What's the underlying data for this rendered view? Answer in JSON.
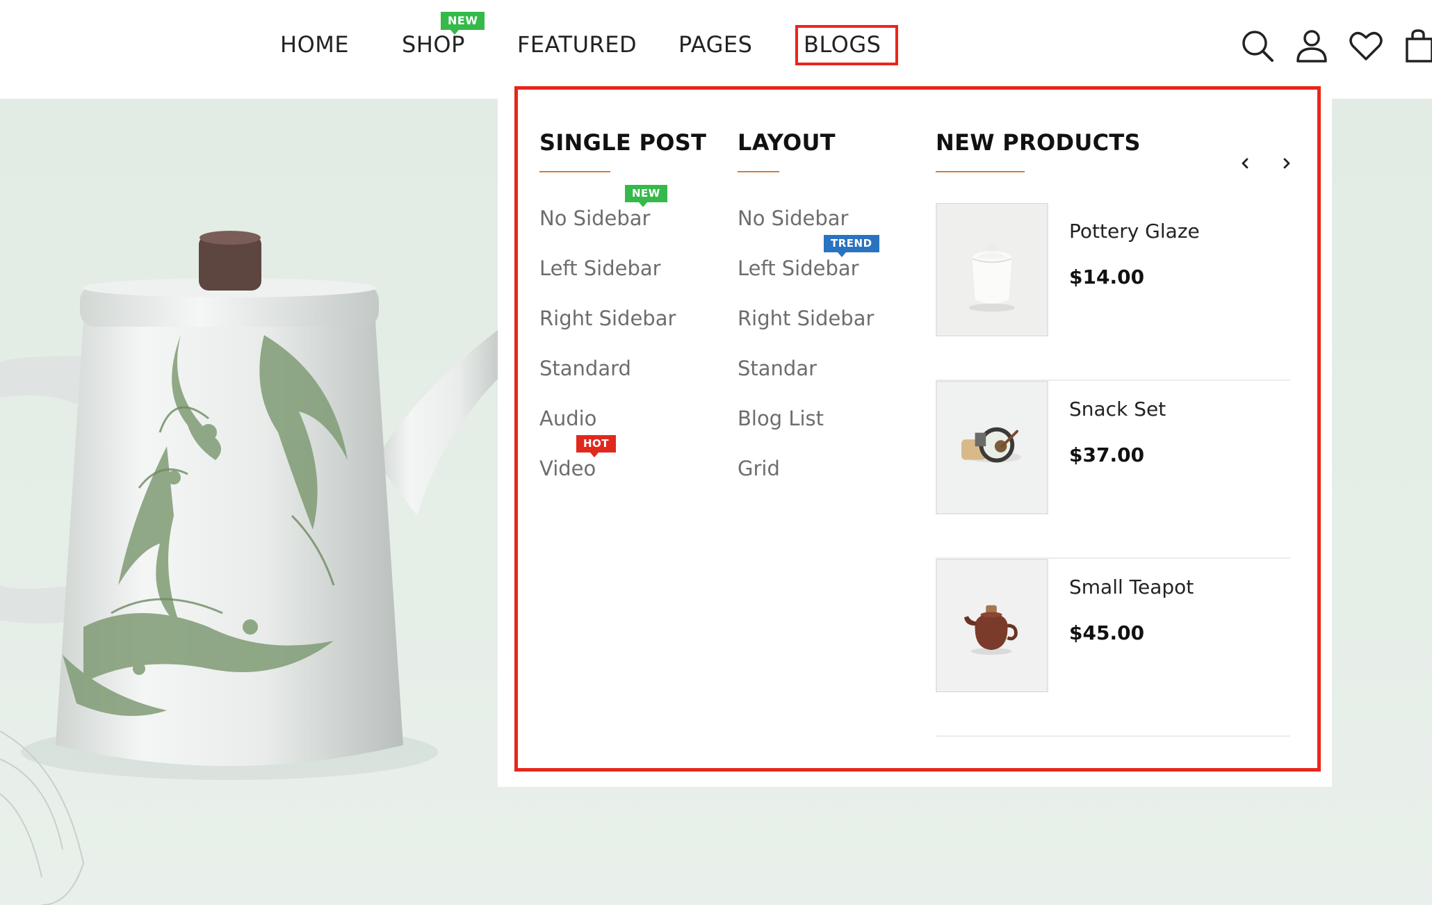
{
  "nav": {
    "items": [
      {
        "label": "HOME"
      },
      {
        "label": "SHOP",
        "badge": "NEW"
      },
      {
        "label": "FEATURED"
      },
      {
        "label": "PAGES"
      },
      {
        "label": "BLOGS",
        "active": true
      }
    ],
    "icons": [
      "search-icon",
      "user-icon",
      "heart-icon",
      "shopping-bag-icon"
    ]
  },
  "dropdown": {
    "single_post": {
      "title": "SINGLE POST",
      "links": [
        {
          "label": "No Sidebar",
          "badge": "NEW"
        },
        {
          "label": "Left Sidebar"
        },
        {
          "label": "Right Sidebar"
        },
        {
          "label": "Standard"
        },
        {
          "label": "Audio"
        },
        {
          "label": "Video",
          "badge": "HOT"
        }
      ]
    },
    "layout": {
      "title": "LAYOUT",
      "links": [
        {
          "label": "No Sidebar"
        },
        {
          "label": "Left Sidebar",
          "badge": "TREND"
        },
        {
          "label": "Right Sidebar"
        },
        {
          "label": "Standar"
        },
        {
          "label": "Blog List"
        },
        {
          "label": "Grid"
        }
      ]
    },
    "new_products": {
      "title": "NEW PRODUCTS",
      "prev_icon": "chevron-left-icon",
      "next_icon": "chevron-right-icon",
      "items": [
        {
          "name": "Pottery Glaze",
          "price": "$14.00"
        },
        {
          "name": "Snack Set",
          "price": "$37.00"
        },
        {
          "name": "Small Teapot",
          "price": "$45.00"
        }
      ]
    }
  },
  "colors": {
    "accent_underline": "#d97a3a",
    "highlight_border": "#e8261b",
    "badge_new": "#35b94a",
    "badge_trend": "#2a73c0",
    "badge_hot": "#e0281e",
    "hero_bg": "#e3ece5"
  }
}
